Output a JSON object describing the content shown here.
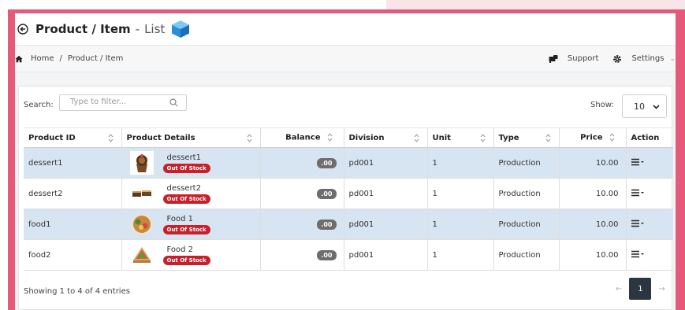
{
  "header": {
    "title": "Product / Item",
    "title_sep": "-",
    "subtitle": "List"
  },
  "breadcrumb": {
    "home": "Home",
    "separator": "/",
    "current": "Product / Item"
  },
  "top_actions": {
    "support_label": "Support",
    "settings_label": "Settings"
  },
  "toolbar": {
    "search_label": "Search:",
    "search_placeholder": "Type to filter...",
    "show_label": "Show:",
    "show_value": "10"
  },
  "table": {
    "columns": [
      "Product ID",
      "Product Details",
      "Balance",
      "Division",
      "Unit",
      "Type",
      "Price",
      "Action"
    ],
    "rows": [
      {
        "id": "dessert1",
        "name": "dessert1",
        "badge": "Out Of Stock",
        "balance": ".00",
        "division": "pd001",
        "unit": "1",
        "type": "Production",
        "price": "10.00",
        "thumb": "cupcake-icon",
        "highlight": true
      },
      {
        "id": "dessert2",
        "name": "dessert2",
        "badge": "Out Of Stock",
        "balance": ".00",
        "division": "pd001",
        "unit": "1",
        "type": "Production",
        "price": "10.00",
        "thumb": "brownie-icon",
        "highlight": false
      },
      {
        "id": "food1",
        "name": "Food 1",
        "badge": "Out Of Stock",
        "balance": ".00",
        "division": "pd001",
        "unit": "1",
        "type": "Production",
        "price": "10.00",
        "thumb": "salad-bowl-icon",
        "highlight": true
      },
      {
        "id": "food2",
        "name": "Food 2",
        "badge": "Out Of Stock",
        "balance": ".00",
        "division": "pd001",
        "unit": "1",
        "type": "Production",
        "price": "10.00",
        "thumb": "sandwich-icon",
        "highlight": false
      }
    ]
  },
  "footer": {
    "info": "Showing 1 to 4 of 4 entries",
    "prev": "←",
    "page": "1",
    "next": "→"
  },
  "colors": {
    "frame": "#e45a78",
    "highlight_row": "#d7e5f2",
    "badge": "#c8202a",
    "page_button": "#2b3640"
  }
}
